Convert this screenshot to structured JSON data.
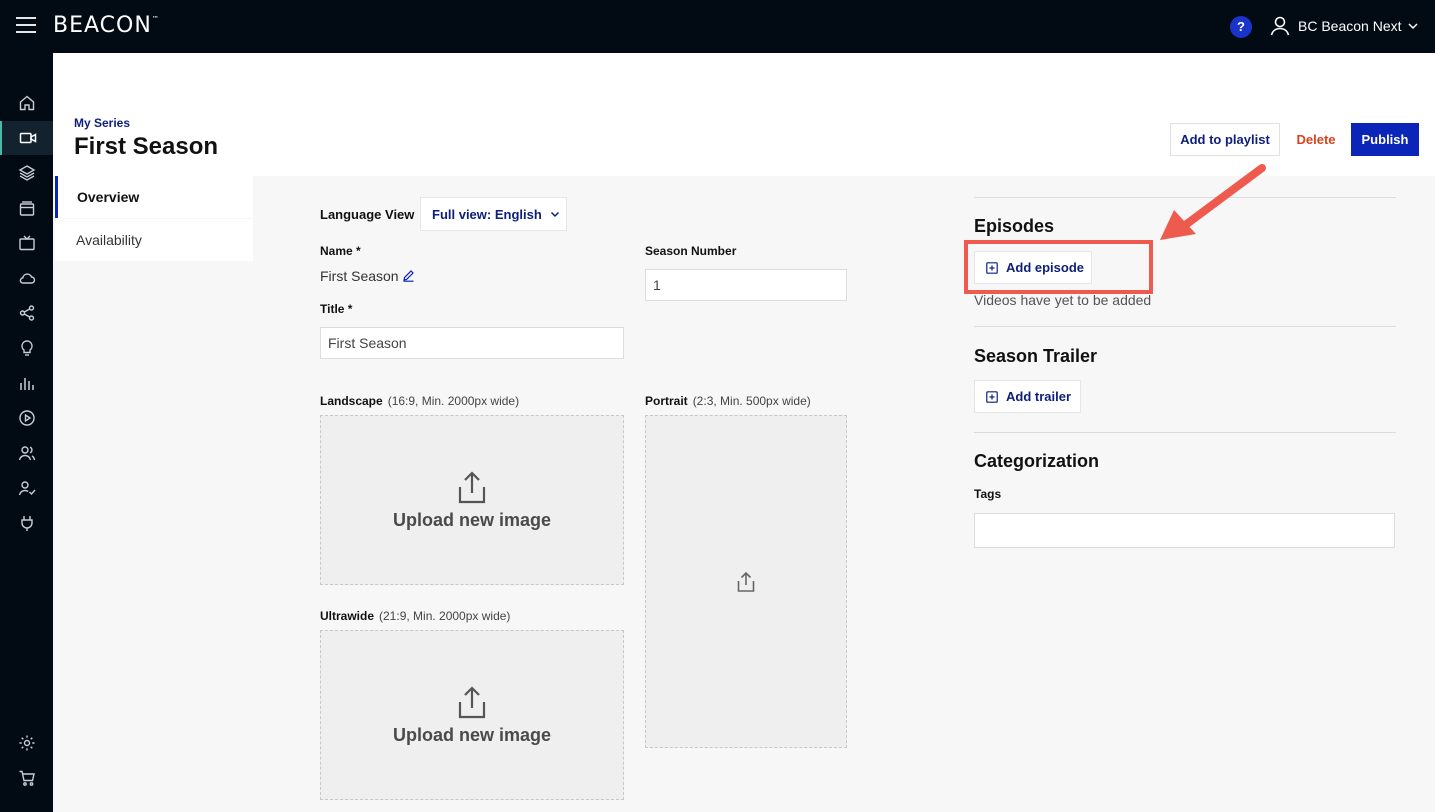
{
  "topbar": {
    "brand": "BEACON",
    "brand_mark": "™",
    "help_label": "?",
    "user_name": "BC Beacon Next"
  },
  "rail": {
    "items": [
      "home-icon",
      "video-icon",
      "layers-icon",
      "collection-icon",
      "tv-icon",
      "cloud-icon",
      "share-icon",
      "lightbulb-icon",
      "analytics-icon",
      "play-circle-icon",
      "users-icon",
      "user-check-icon",
      "plug-icon",
      "gear-icon",
      "cart-icon"
    ],
    "active": "video-icon"
  },
  "header": {
    "breadcrumb": "My Series",
    "title": "First Season",
    "add_to_playlist": "Add to playlist",
    "delete": "Delete",
    "publish": "Publish"
  },
  "tabs": [
    {
      "label": "Overview"
    },
    {
      "label": "Availability"
    }
  ],
  "form": {
    "language_label": "Language View",
    "language_value": "Full view: English",
    "name_label": "Name *",
    "name_value": "First Season",
    "season_number_label": "Season Number",
    "season_number_value": "1",
    "title_label": "Title *",
    "title_value": "First Season",
    "landscape_label": "Landscape",
    "landscape_hint": "(16:9, Min. 2000px wide)",
    "portrait_label": "Portrait",
    "portrait_hint": "(2:3, Min. 500px wide)",
    "ultrawide_label": "Ultrawide",
    "ultrawide_hint": "(21:9, Min. 2000px wide)",
    "upload_text": "Upload new image"
  },
  "right": {
    "episodes_title": "Episodes",
    "add_episode": "Add episode",
    "episodes_empty": "Videos have yet to be added",
    "trailer_title": "Season Trailer",
    "add_trailer": "Add trailer",
    "categorization_title": "Categorization",
    "tags_label": "Tags"
  },
  "colors": {
    "accent": "#0a25b8",
    "danger": "#d8421d",
    "annotation": "#ef5a4e",
    "nav_bg": "#020a14"
  }
}
